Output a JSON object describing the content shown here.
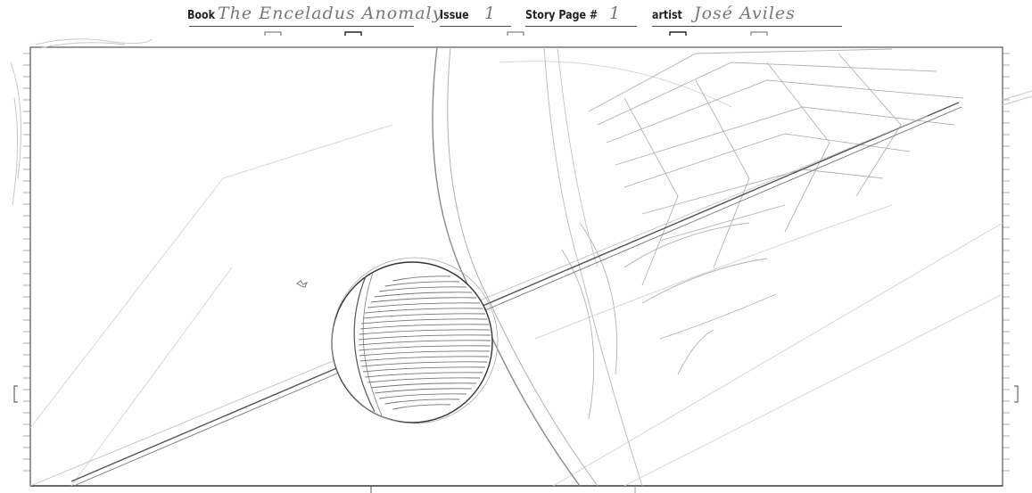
{
  "header": {
    "book_label": "Book",
    "book_value": "The Enceladus Anomaly",
    "issue_label": "Issue",
    "issue_value": "1",
    "page_label": "Story Page #",
    "page_value": "1",
    "artist_label": "artist",
    "artist_value": "José Aviles"
  },
  "colors": {
    "ink": "#222222",
    "pencil": "#8a8a8a",
    "light_pencil": "#c4c4c4",
    "border": "#555555"
  }
}
